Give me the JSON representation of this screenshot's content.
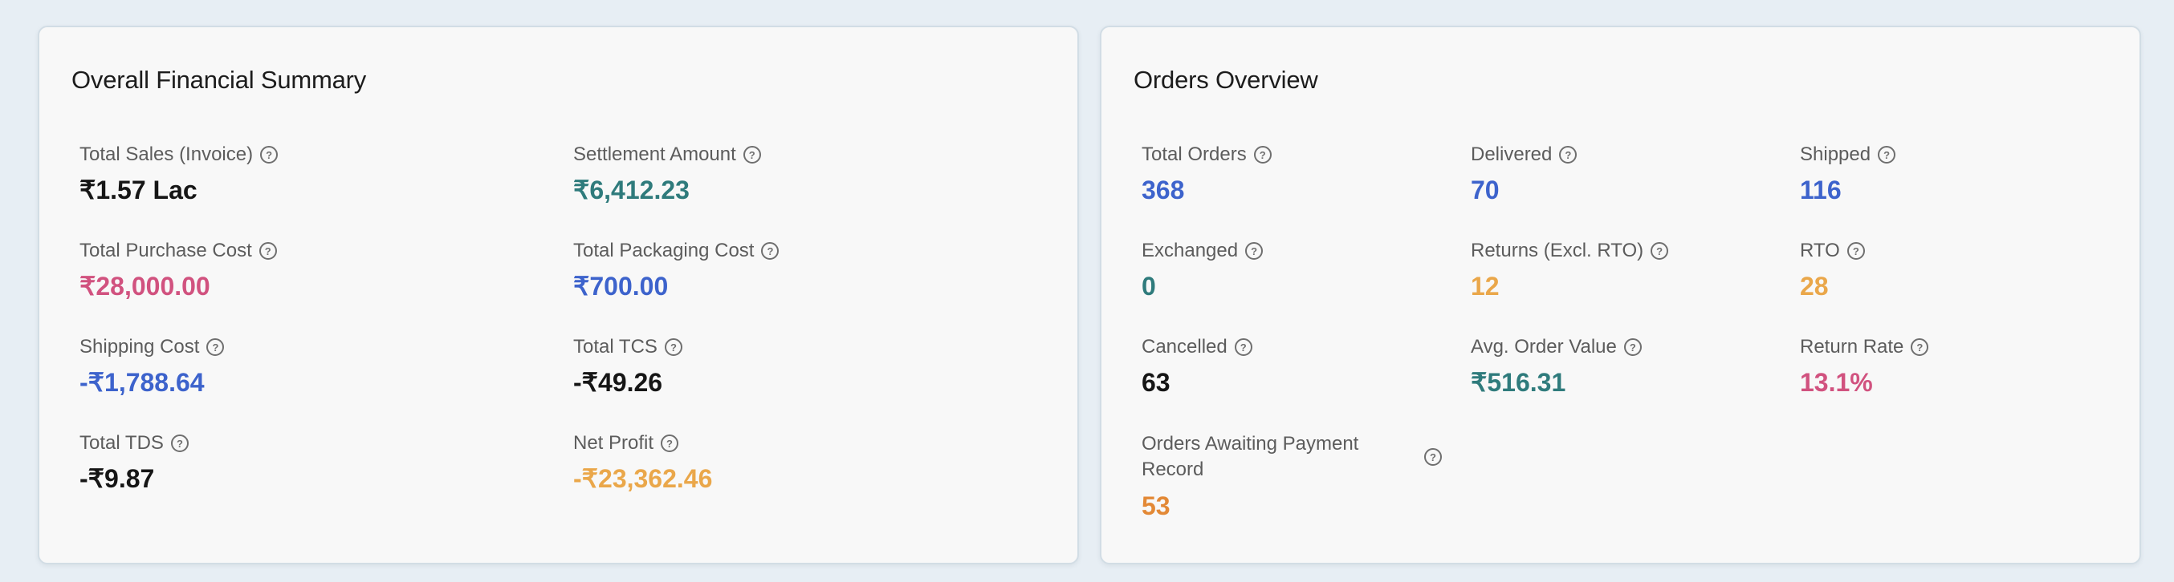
{
  "financial_summary": {
    "title": "Overall Financial Summary",
    "metrics": [
      {
        "label": "Total Sales (Invoice)",
        "value": "₹1.57 Lac",
        "color": "#161616"
      },
      {
        "label": "Settlement Amount",
        "value": "₹6,412.23",
        "color": "#2f7b7c"
      },
      {
        "label": "Total Purchase Cost",
        "value": "₹28,000.00",
        "color": "#d1527f"
      },
      {
        "label": "Total Packaging Cost",
        "value": "₹700.00",
        "color": "#3d63cc"
      },
      {
        "label": "Shipping Cost",
        "value": "-₹1,788.64",
        "color": "#3d63cc"
      },
      {
        "label": "Total TCS",
        "value": "-₹49.26",
        "color": "#161616"
      },
      {
        "label": "Total TDS",
        "value": "-₹9.87",
        "color": "#161616"
      },
      {
        "label": "Net Profit",
        "value": "-₹23,362.46",
        "color": "#eaa74a"
      }
    ]
  },
  "orders_overview": {
    "title": "Orders Overview",
    "metrics": [
      {
        "label": "Total Orders",
        "value": "368",
        "color": "#3d63cc"
      },
      {
        "label": "Delivered",
        "value": "70",
        "color": "#3d63cc"
      },
      {
        "label": "Shipped",
        "value": "116",
        "color": "#3d63cc"
      },
      {
        "label": "Exchanged",
        "value": "0",
        "color": "#2f7b7c"
      },
      {
        "label": "Returns (Excl. RTO)",
        "value": "12",
        "color": "#eaa74a"
      },
      {
        "label": "RTO",
        "value": "28",
        "color": "#eaa74a"
      },
      {
        "label": "Cancelled",
        "value": "63",
        "color": "#161616"
      },
      {
        "label": "Avg. Order Value",
        "value": "₹516.31",
        "color": "#2f7b7c"
      },
      {
        "label": "Return Rate",
        "value": "13.1%",
        "color": "#d1527f"
      },
      {
        "label": "Orders Awaiting Payment Record",
        "value": "53",
        "color": "#e38936"
      }
    ]
  },
  "icons": {
    "help": "?"
  }
}
